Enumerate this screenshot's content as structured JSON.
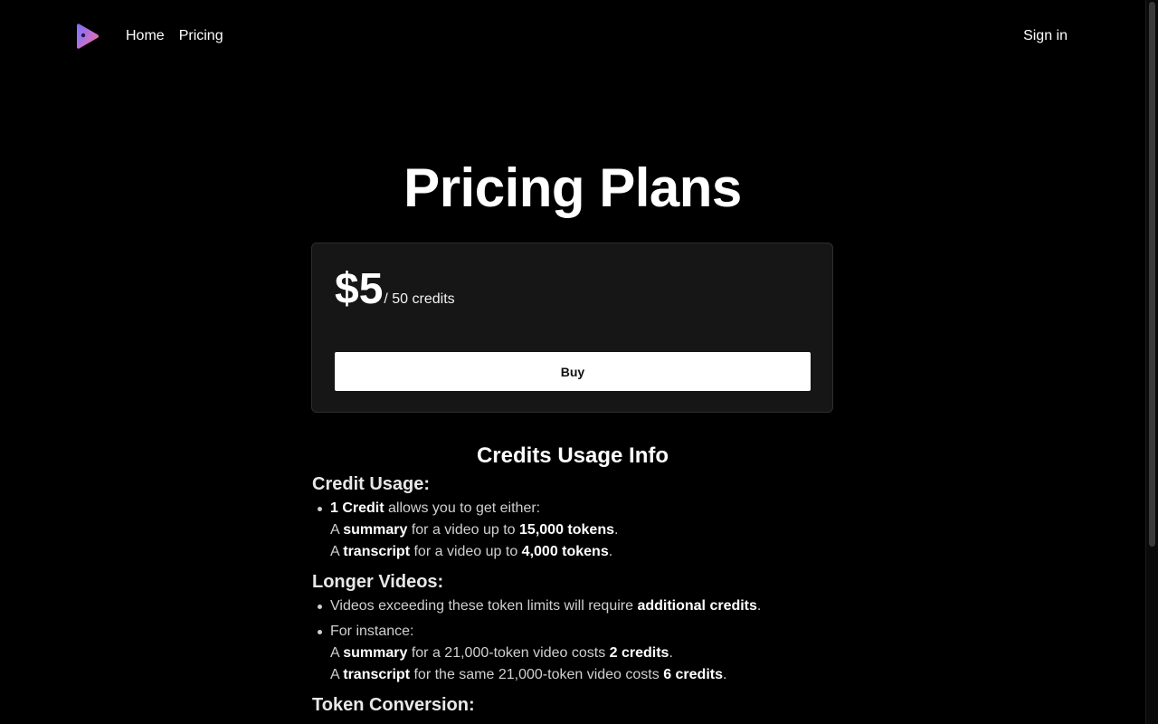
{
  "nav": {
    "logo_alt": "app-logo",
    "links": [
      "Home",
      "Pricing"
    ],
    "signin": "Sign in"
  },
  "title": "Pricing Plans",
  "plan": {
    "price": "$5",
    "unit": "/ 50 credits",
    "buy_label": "Buy"
  },
  "info": {
    "title": "Credits Usage Info",
    "sections": [
      {
        "title": "Credit Usage:",
        "item1": {
          "b1": "1 Credit",
          "t1": " allows you to get either:",
          "line1": {
            "a": "A ",
            "b": "summary",
            "c": " for a video up to ",
            "d": "15,000 tokens",
            "e": "."
          },
          "line2": {
            "a": "A ",
            "b": "transcript",
            "c": " for a video up to ",
            "d": "4,000 tokens",
            "e": "."
          }
        }
      },
      {
        "title": "Longer Videos:",
        "item1": {
          "t1": "Videos exceeding these token limits will require ",
          "b1": "additional credits",
          "t2": "."
        },
        "item2": {
          "t1": "For instance:",
          "line1": {
            "a": "A ",
            "b": "summary",
            "c": " for a 21,000-token video costs ",
            "d": "2 credits",
            "e": "."
          },
          "line2": {
            "a": "A ",
            "b": "transcript",
            "c": " for the same 21,000-token video costs ",
            "d": "6 credits",
            "e": "."
          }
        }
      },
      {
        "title": "Token Conversion:"
      }
    ]
  },
  "colors": {
    "background": "#000000",
    "card": "#161616",
    "button": "#ffffff"
  }
}
